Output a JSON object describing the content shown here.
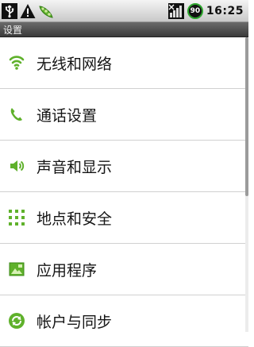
{
  "status_bar": {
    "icons_left": [
      "usb-icon",
      "warning-icon",
      "pea-app-icon"
    ],
    "signal_icon": "signal-bars-icon",
    "battery_level": "90",
    "time": "16:25"
  },
  "title_bar": {
    "title": "设置"
  },
  "settings": {
    "items": [
      {
        "label": "无线和网络",
        "icon": "wifi-icon"
      },
      {
        "label": "通话设置",
        "icon": "phone-icon"
      },
      {
        "label": "声音和显示",
        "icon": "speaker-icon"
      },
      {
        "label": "地点和安全",
        "icon": "grid-dots-icon"
      },
      {
        "label": "应用程序",
        "icon": "applications-icon"
      },
      {
        "label": "帐户与同步",
        "icon": "sync-icon"
      }
    ]
  },
  "colors": {
    "accent": "#5fb12b",
    "title_bar": "#4a4a4a",
    "battery_ring": "#2ea52e"
  }
}
